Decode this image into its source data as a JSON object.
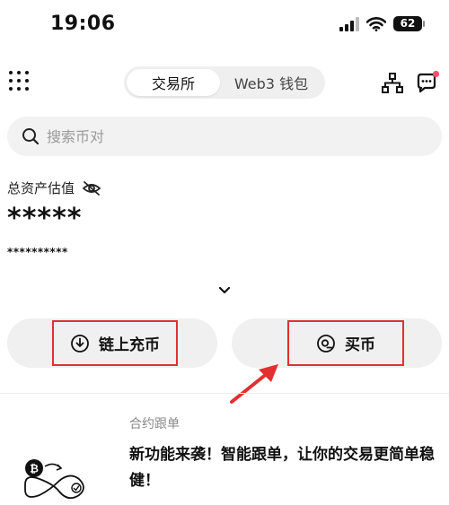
{
  "status_bar": {
    "time": "19:06",
    "battery": "62"
  },
  "header": {
    "tabs": [
      {
        "label": "交易所",
        "active": true
      },
      {
        "label": "Web3 钱包",
        "active": false
      }
    ],
    "icons": [
      "menu-grid-icon",
      "network-icon",
      "chat-icon"
    ],
    "notification_dot_color": "#ff4d6a"
  },
  "search": {
    "placeholder": "搜索币对"
  },
  "assets": {
    "label": "总资产估值",
    "value": "*****",
    "sub_value": "**********"
  },
  "actions": {
    "deposit_label": "链上充币",
    "buy_label": "买币"
  },
  "promo": {
    "tag": "合约跟单",
    "text": "新功能来袭！智能跟单，让你的交易更简单稳健！"
  },
  "colors": {
    "highlight": "#e23030",
    "button_bg": "#f0f0f0",
    "search_bg": "#f2f2f2"
  }
}
